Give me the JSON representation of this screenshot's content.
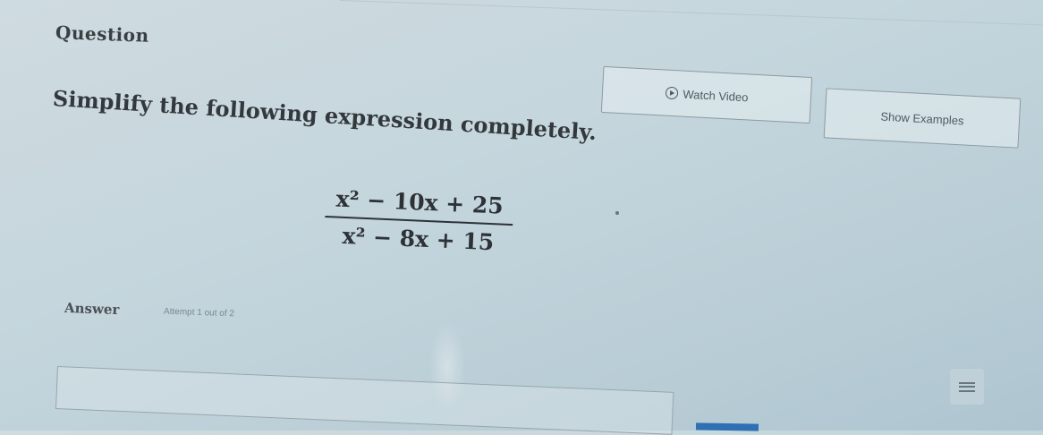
{
  "question": {
    "heading": "Question",
    "prompt": "Simplify the following expression completely.",
    "numerator": "x² − 10x + 25",
    "denominator": "x² − 8x + 15"
  },
  "buttons": {
    "watch_video": "Watch Video",
    "show_examples": "Show Examples"
  },
  "answer": {
    "label": "Answer",
    "attempt_text": "Attempt 1 out of 2",
    "input_value": ""
  },
  "icons": {
    "video": "play-circle-icon",
    "keyboard": "keyboard-icon"
  },
  "colors": {
    "accent": "#2f6fb4",
    "background": "#c5d6dd"
  }
}
